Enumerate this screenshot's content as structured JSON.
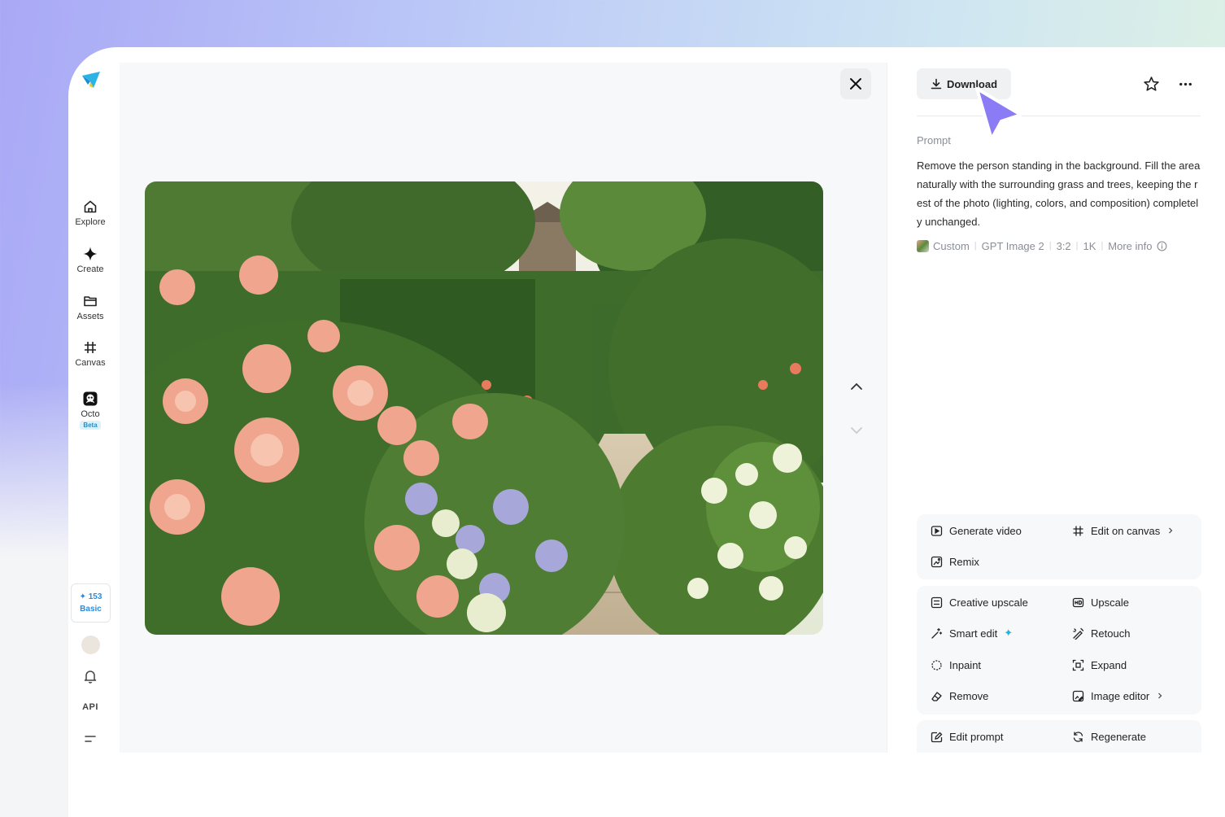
{
  "sidebar": {
    "items": [
      {
        "label": "Explore"
      },
      {
        "label": "Create"
      },
      {
        "label": "Assets"
      },
      {
        "label": "Canvas"
      },
      {
        "label": "Octo",
        "badge": "Beta"
      }
    ],
    "credits": {
      "count": "153",
      "plan": "Basic"
    },
    "api_label": "API"
  },
  "panel": {
    "download_label": "Download",
    "prompt_title": "Prompt",
    "prompt_text": "Remove the person standing in the background. Fill the area naturally with the surrounding grass and trees, keeping the rest of the photo (lighting, colors, and composition) completely unchanged.",
    "meta": {
      "style": "Custom",
      "model": "GPT Image 2",
      "ratio": "3:2",
      "resolution": "1K",
      "more_info": "More info"
    },
    "actions_group1": {
      "generate_video": "Generate video",
      "edit_on_canvas": "Edit on canvas",
      "remix": "Remix"
    },
    "actions_group2": {
      "creative_upscale": "Creative upscale",
      "upscale": "Upscale",
      "smart_edit": "Smart edit",
      "retouch": "Retouch",
      "inpaint": "Inpaint",
      "expand": "Expand",
      "remove": "Remove",
      "image_editor": "Image editor"
    },
    "actions_group3": {
      "edit_prompt": "Edit prompt",
      "regenerate": "Regenerate"
    }
  },
  "colors": {
    "accent_purple": "#8b7cf6",
    "credit_blue": "#2a8be0",
    "smart_edit_spark": "#1fb6d9"
  }
}
